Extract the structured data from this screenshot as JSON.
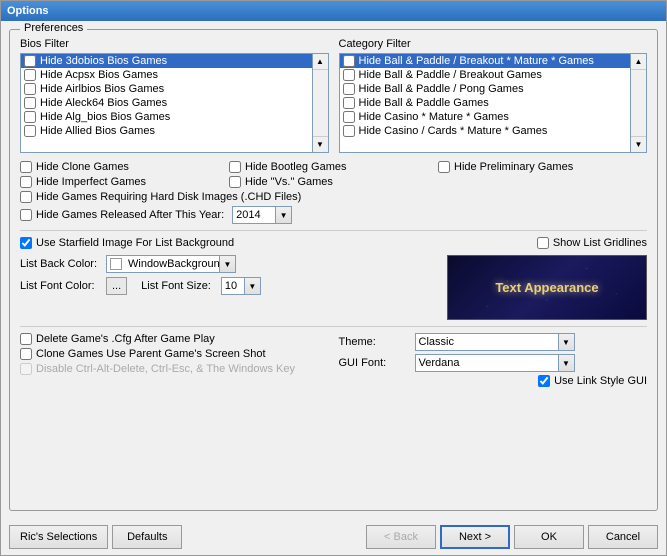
{
  "window": {
    "title": "Options"
  },
  "preferences": {
    "title": "Preferences",
    "bios_filter": {
      "label": "Bios Filter",
      "items": [
        {
          "text": "Hide 3dobios Bios Games",
          "checked": false,
          "selected": true
        },
        {
          "text": "Hide Acpsx Bios Games",
          "checked": false,
          "selected": false
        },
        {
          "text": "Hide Airlbios Bios Games",
          "checked": false,
          "selected": false
        },
        {
          "text": "Hide Aleck64 Bios Games",
          "checked": false,
          "selected": false
        },
        {
          "text": "Hide Alg_bios Bios Games",
          "checked": false,
          "selected": false
        },
        {
          "text": "Hide Allied Bios Games",
          "checked": false,
          "selected": false
        }
      ]
    },
    "category_filter": {
      "label": "Category Filter",
      "items": [
        {
          "text": "Hide Ball & Paddle / Breakout * Mature * Games",
          "checked": false,
          "selected": true
        },
        {
          "text": "Hide Ball & Paddle / Breakout Games",
          "checked": false,
          "selected": false
        },
        {
          "text": "Hide Ball & Paddle / Pong Games",
          "checked": false,
          "selected": false
        },
        {
          "text": "Hide Ball & Paddle Games",
          "checked": false,
          "selected": false
        },
        {
          "text": "Hide Casino * Mature * Games",
          "checked": false,
          "selected": false
        },
        {
          "text": "Hide Casino / Cards * Mature * Games",
          "checked": false,
          "selected": false
        }
      ]
    },
    "options": {
      "hide_clone_games": {
        "label": "Hide Clone Games",
        "checked": false
      },
      "hide_bootleg_games": {
        "label": "Hide Bootleg Games",
        "checked": false
      },
      "hide_preliminary_games": {
        "label": "Hide Preliminary Games",
        "checked": false
      },
      "hide_imperfect_games": {
        "label": "Hide Imperfect Games",
        "checked": false
      },
      "hide_vs_games": {
        "label": "Hide \"Vs.\" Games",
        "checked": false
      },
      "hide_requiring_hd": {
        "label": "Hide Games Requiring Hard Disk Images (.CHD Files)",
        "checked": false
      },
      "hide_released_after": {
        "label": "Hide Games Released After This Year:",
        "checked": false
      },
      "year_value": "2014"
    },
    "starfield": {
      "label": "Use Starfield Image For List Background",
      "checked": true
    },
    "show_gridlines": {
      "label": "Show List Gridlines",
      "checked": false
    },
    "list_back_color": {
      "label": "List Back Color:",
      "value": "WindowBackground"
    },
    "list_font_color": {
      "label": "List Font Color:",
      "btn_label": "..."
    },
    "list_font_size": {
      "label": "List Font Size:",
      "value": "10"
    },
    "text_appearance_label": "Text Appearance",
    "delete_cfg": {
      "label": "Delete Game's .Cfg After Game Play",
      "checked": false
    },
    "clone_screen": {
      "label": "Clone Games Use Parent Game's Screen Shot",
      "checked": false
    },
    "disable_ctrl": {
      "label": "Disable Ctrl-Alt-Delete, Ctrl-Esc, & The Windows Key",
      "checked": false,
      "disabled": true
    },
    "theme": {
      "label": "Theme:",
      "value": "Classic",
      "options": [
        "Classic"
      ]
    },
    "gui_font": {
      "label": "GUI Font:",
      "value": "Verdana",
      "options": [
        "Verdana"
      ]
    },
    "use_link_style": {
      "label": "Use Link Style GUI",
      "checked": true
    }
  },
  "buttons": {
    "rics_selections": "Ric's Selections",
    "defaults": "Defaults",
    "back": "< Back",
    "next": "Next >",
    "ok": "OK",
    "cancel": "Cancel"
  }
}
